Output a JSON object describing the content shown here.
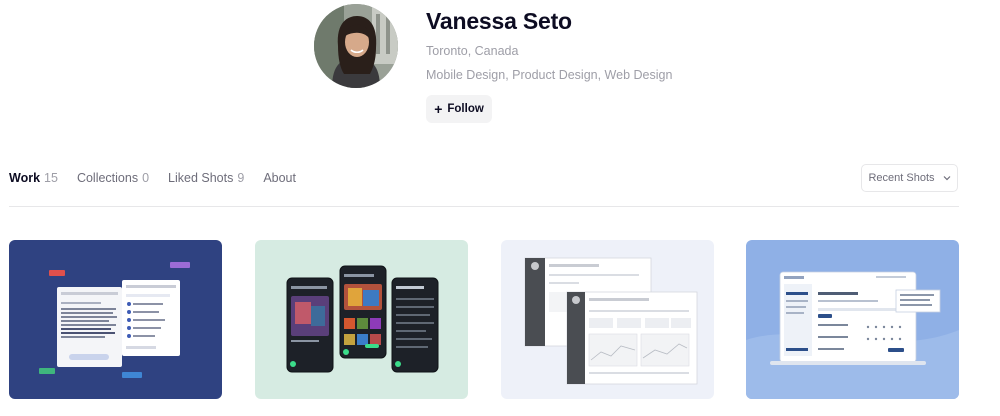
{
  "profile": {
    "name": "Vanessa Seto",
    "location": "Toronto, Canada",
    "skills": "Mobile Design, Product Design, Web Design",
    "follow_label": "Follow",
    "follow_icon": "plus-icon"
  },
  "tabs": [
    {
      "label": "Work",
      "count": "15"
    },
    {
      "label": "Collections",
      "count": "0"
    },
    {
      "label": "Liked Shots",
      "count": "9"
    },
    {
      "label": "About",
      "count": ""
    }
  ],
  "sort": {
    "selected": "Recent Shots",
    "icon": "chevron-down-icon"
  },
  "shots": [
    {
      "theme": "task-app",
      "background": "#2f4281"
    },
    {
      "theme": "game-app",
      "background": "#d6ebe2"
    },
    {
      "theme": "dashboard",
      "background": "#eef1f9"
    },
    {
      "theme": "laptop-web",
      "background": "#8fb0e6"
    }
  ],
  "colors": {
    "text": "#0d0c22",
    "muted": "#9e9ea7",
    "border": "#e7e7e9",
    "button_bg": "#f3f3f4"
  }
}
